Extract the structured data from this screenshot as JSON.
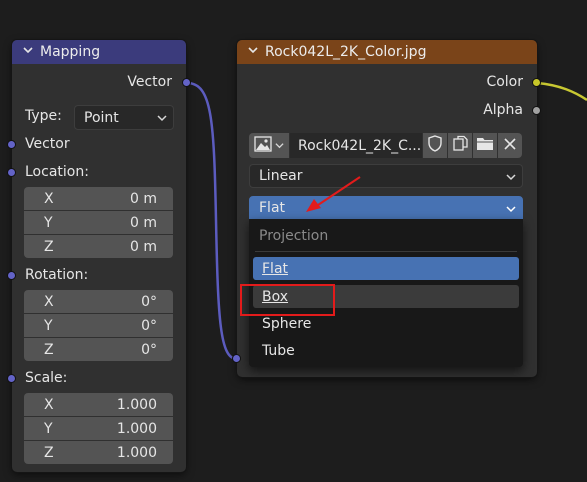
{
  "mapping_node": {
    "title": "Mapping",
    "output_label": "Vector",
    "type_label": "Type:",
    "type_value": "Point",
    "vector_label": "Vector",
    "location_label": "Location:",
    "location": [
      {
        "axis": "X",
        "value": "0 m"
      },
      {
        "axis": "Y",
        "value": "0 m"
      },
      {
        "axis": "Z",
        "value": "0 m"
      }
    ],
    "rotation_label": "Rotation:",
    "rotation": [
      {
        "axis": "X",
        "value": "0°"
      },
      {
        "axis": "Y",
        "value": "0°"
      },
      {
        "axis": "Z",
        "value": "0°"
      }
    ],
    "scale_label": "Scale:",
    "scale": [
      {
        "axis": "X",
        "value": "1.000"
      },
      {
        "axis": "Y",
        "value": "1.000"
      },
      {
        "axis": "Z",
        "value": "1.000"
      }
    ]
  },
  "image_node": {
    "title": "Rock042L_2K_Color.jpg",
    "output_color": "Color",
    "output_alpha": "Alpha",
    "image_name": "Rock042L_2K_C...",
    "interpolation": "Linear",
    "projection_value": "Flat",
    "menu": {
      "header": "Projection",
      "items": [
        "Flat",
        "Box",
        "Sphere",
        "Tube"
      ],
      "selected": "Flat",
      "hovered": "Box"
    }
  },
  "colors": {
    "mapping_header": "#3b3b7c",
    "image_header": "#7a4419",
    "vector_socket": "#6363c7",
    "color_socket": "#c7c729",
    "link_vector": "#5c5cbf",
    "link_color": "#c8c832",
    "selection": "#4772b3",
    "annotation_red": "#e31b1b"
  },
  "icons": {
    "image_type": "image-icon",
    "fake_user": "shield-icon",
    "duplicate": "duplicate-icon",
    "open": "folder-icon",
    "unlink": "close-icon",
    "annotation": "red-arrow"
  }
}
